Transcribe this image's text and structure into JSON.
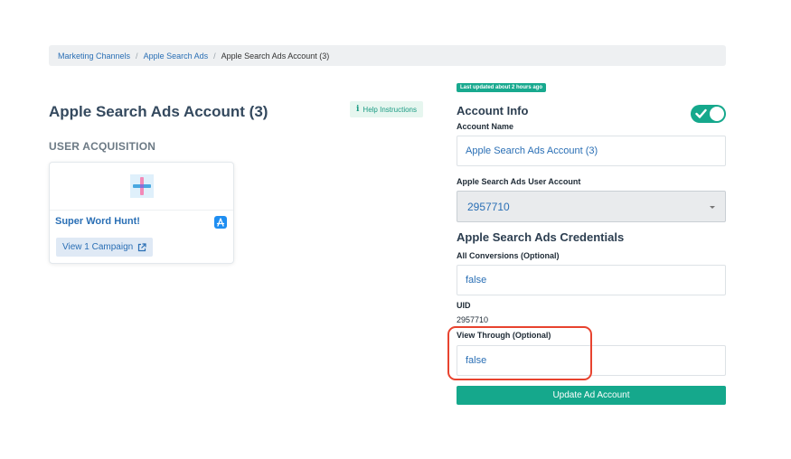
{
  "breadcrumb": {
    "items": [
      "Marketing Channels",
      "Apple Search Ads"
    ],
    "current": "Apple Search Ads Account (3)",
    "separator": "/"
  },
  "page": {
    "title": "Apple Search Ads Account (3)",
    "help_label": "Help Instructions",
    "section_heading": "USER ACQUISITION"
  },
  "app_card": {
    "name": "Super Word Hunt!",
    "view_label": "View 1 Campaign"
  },
  "account_info": {
    "updated_badge": "Last updated about 2 hours ago",
    "heading": "Account Info",
    "enabled": true,
    "account_name_label": "Account Name",
    "account_name_value": "Apple Search Ads Account (3)",
    "user_account_label": "Apple Search Ads User Account",
    "user_account_value": "2957710"
  },
  "credentials": {
    "heading": "Apple Search Ads Credentials",
    "all_conversions_label": "All Conversions (Optional)",
    "all_conversions_value": "false",
    "uid_label": "UID",
    "uid_value": "2957710",
    "view_through_label": "View Through (Optional)",
    "view_through_value": "false"
  },
  "actions": {
    "update_label": "Update Ad Account"
  },
  "colors": {
    "accent": "#15a88c",
    "link": "#2a6fb5",
    "highlight": "#e8432f"
  }
}
